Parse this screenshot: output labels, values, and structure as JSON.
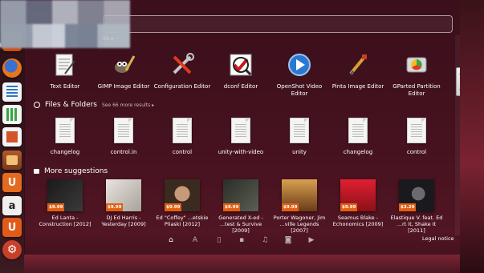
{
  "search": {
    "breadcrumb": "lts ▸"
  },
  "apps": [
    {
      "label": "Text Editor",
      "icon": "text-editor-icon"
    },
    {
      "label": "GIMP Image Editor",
      "icon": "gimp-icon"
    },
    {
      "label": "Configuration Editor",
      "icon": "tools-icon"
    },
    {
      "label": "dconf Editor",
      "icon": "dconf-icon"
    },
    {
      "label": "OpenShot Video Editor",
      "icon": "openshot-icon"
    },
    {
      "label": "Pinta Image Editor",
      "icon": "pinta-icon"
    },
    {
      "label": "GParted Partition Editor",
      "icon": "gparted-icon"
    }
  ],
  "files_section": {
    "title": "Files & Folders",
    "see_more": "See 66 more results ▸"
  },
  "files": [
    {
      "label": "changelog"
    },
    {
      "label": "control.in"
    },
    {
      "label": "control"
    },
    {
      "label": "unity-with-video"
    },
    {
      "label": "unity"
    },
    {
      "label": "changelog"
    },
    {
      "label": "control"
    }
  ],
  "suggestions_section": {
    "title": "More suggestions"
  },
  "suggestions": [
    {
      "label": "Ed Lanta - Construction [2012]",
      "price": "$9.99",
      "color": "#2a2a2a"
    },
    {
      "label": "DJ Ed Harris - Yesterday [2009]",
      "price": "$9.99",
      "color": "#c8c2bc"
    },
    {
      "label": "Ed \"Coffey\" ...etskie Pliaski [2012]",
      "price": "$9.99",
      "color": "#5b4a3c"
    },
    {
      "label": "Generated X-ed - ...test & Survive [2009]",
      "price": "$9.99",
      "color": "#3a3f36"
    },
    {
      "label": "Porter Wagoner, Jim ...ville Legends [2007]",
      "price": "$9.99",
      "color": "#8a5a2a"
    },
    {
      "label": "Seamus Blake - Echonomics [2009]",
      "price": "$9.99",
      "color": "#b81e2a"
    },
    {
      "label": "Elastique V. feat. Ed ...rt It, Shake It [2011]",
      "price": "$3.29",
      "color": "#222226"
    }
  ],
  "lenses": [
    "home-lens-icon",
    "apps-lens-icon",
    "files-lens-icon",
    "social-lens-icon",
    "music-lens-icon",
    "photo-lens-icon",
    "video-lens-icon"
  ],
  "legal": "Legal notice",
  "launcher": [
    {
      "name": "dash-home-launcher",
      "color": "#e86e2a"
    },
    {
      "name": "firefox-launcher",
      "color": "#e66a1c"
    },
    {
      "name": "libreoffice-writer-launcher",
      "color": "#2c74c4"
    },
    {
      "name": "libreoffice-calc-launcher",
      "color": "#3aa246"
    },
    {
      "name": "libreoffice-impress-launcher",
      "color": "#d2552a"
    },
    {
      "name": "software-center-launcher",
      "color": "#d84a1a"
    },
    {
      "name": "ubuntu-one-launcher",
      "color": "#e36a1e"
    },
    {
      "name": "amazon-launcher",
      "color": "#f0f0f0"
    },
    {
      "name": "ubuntu-one-music-launcher",
      "color": "#e05a18"
    },
    {
      "name": "system-settings-launcher",
      "color": "#c8402a"
    }
  ]
}
